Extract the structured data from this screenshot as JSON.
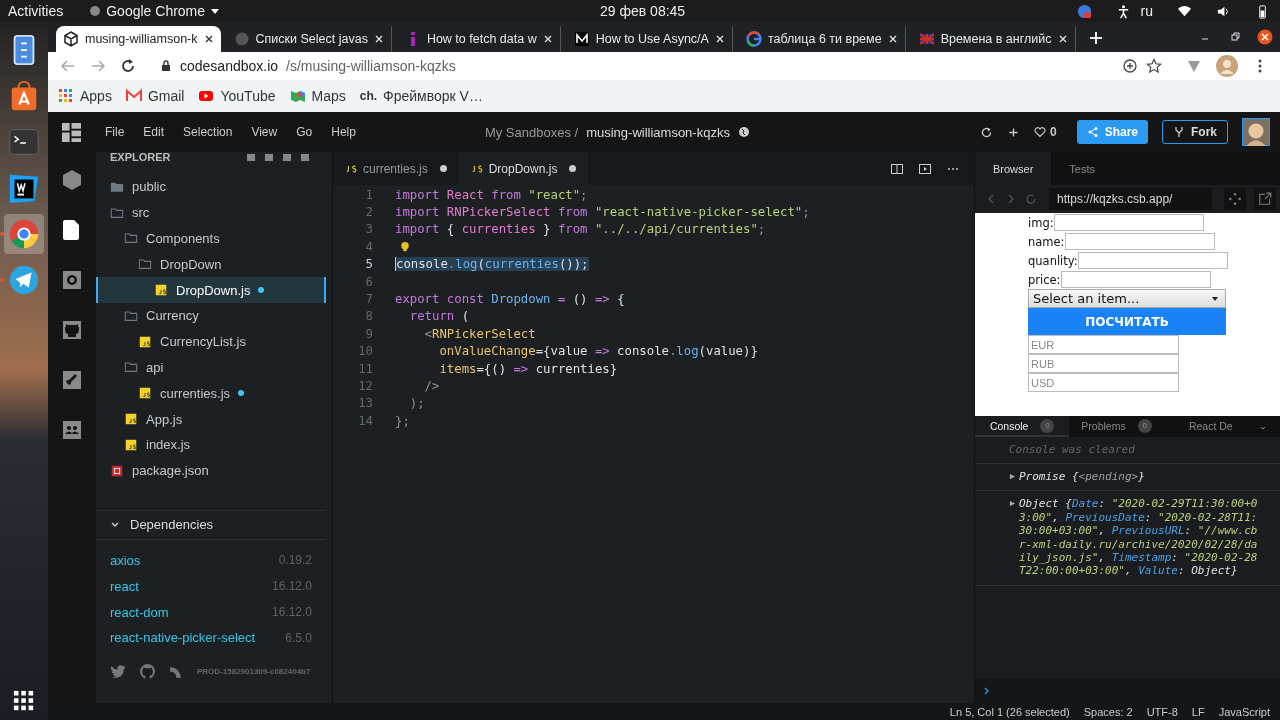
{
  "system_bar": {
    "activities": "Activities",
    "app_menu": "Google Chrome",
    "clock": "29 фев  08:45",
    "language": "ru"
  },
  "dock": [
    {
      "kind": "files",
      "selected": false,
      "running": false
    },
    {
      "kind": "store",
      "selected": false,
      "running": false
    },
    {
      "kind": "terminal",
      "selected": false,
      "running": false
    },
    {
      "kind": "webstorm",
      "selected": false,
      "running": false
    },
    {
      "kind": "chrome",
      "selected": true,
      "running": true
    },
    {
      "kind": "telegram",
      "selected": false,
      "running": true
    }
  ],
  "browser_tabs": [
    {
      "title": "musing-williamson-k",
      "kind": "cube",
      "selected": true
    },
    {
      "title": "Списки Select javas",
      "kind": "globe",
      "selected": false
    },
    {
      "title": "How to fetch data w",
      "kind": "purple",
      "selected": false
    },
    {
      "title": "How to Use Async/A",
      "kind": "medium",
      "selected": false
    },
    {
      "title": "таблица 6 ти време",
      "kind": "google",
      "selected": false
    },
    {
      "title": "Времена в английс",
      "kind": "flag",
      "selected": false
    }
  ],
  "address": {
    "host": "codesandbox.io",
    "path": "/s/musing-williamson-kqzks"
  },
  "bookmarks": [
    {
      "label": "Apps",
      "kind": "apps"
    },
    {
      "label": "Gmail",
      "kind": "gmail"
    },
    {
      "label": "YouTube",
      "kind": "youtube"
    },
    {
      "label": "Maps",
      "kind": "maps"
    },
    {
      "label": "Фреймворк V…",
      "kind": "text",
      "logo": "ch."
    }
  ],
  "menu": [
    "File",
    "Edit",
    "Selection",
    "View",
    "Go",
    "Help"
  ],
  "breadcrumb": {
    "parent": "My Sandboxes /",
    "name": "musing-williamson-kqzks"
  },
  "likes": "0",
  "share": "Share",
  "fork": "Fork",
  "activity": [
    {
      "kind": "cube",
      "selected": false
    },
    {
      "kind": "file",
      "selected": true
    },
    {
      "kind": "gear",
      "selected": false
    },
    {
      "kind": "github",
      "selected": false
    },
    {
      "kind": "rocket",
      "selected": false
    },
    {
      "kind": "people",
      "selected": false
    }
  ],
  "explorer": {
    "title": "EXPLORER",
    "tree": [
      {
        "name": "public",
        "kind": "folder",
        "expanded": false,
        "selected": false,
        "modified": false
      },
      {
        "name": "src",
        "kind": "folder",
        "expanded": true,
        "selected": false,
        "modified": false,
        "children": [
          {
            "name": "Components",
            "kind": "folder",
            "expanded": true,
            "selected": false,
            "modified": false,
            "children": [
              {
                "name": "DropDown",
                "kind": "folder",
                "expanded": true,
                "selected": false,
                "modified": false,
                "children": [
                  {
                    "name": "DropDown.js",
                    "kind": "js",
                    "selected": true,
                    "modified": true
                  }
                ]
              }
            ]
          },
          {
            "name": "Currency",
            "kind": "folder",
            "expanded": true,
            "selected": false,
            "modified": false,
            "children": [
              {
                "name": "CurrencyList.js",
                "kind": "js",
                "selected": false,
                "modified": false
              }
            ]
          },
          {
            "name": "api",
            "kind": "folder",
            "expanded": true,
            "selected": false,
            "modified": false,
            "children": [
              {
                "name": "currenties.js",
                "kind": "js",
                "selected": false,
                "modified": true
              }
            ]
          },
          {
            "name": "App.js",
            "kind": "js",
            "selected": false,
            "modified": false
          },
          {
            "name": "index.js",
            "kind": "js",
            "selected": false,
            "modified": false
          }
        ]
      },
      {
        "name": "package.json",
        "kind": "json",
        "selected": false,
        "modified": false
      }
    ]
  },
  "dependencies": {
    "title": "Dependencies",
    "expanded": true,
    "items": [
      {
        "name": "axios",
        "version": "0.19.2"
      },
      {
        "name": "react",
        "version": "16.12.0"
      },
      {
        "name": "react-dom",
        "version": "16.12.0"
      },
      {
        "name": "react-native-picker-select",
        "version": "6.5.0"
      }
    ]
  },
  "build": "PROD-1582901309-c082404b7",
  "editor_tabs": [
    {
      "name": "currenties.js",
      "selected": false,
      "modified": true
    },
    {
      "name": "DropDown.js",
      "selected": true,
      "modified": true
    }
  ],
  "code": [
    {
      "n": "1",
      "selected": false,
      "lightbulb": false,
      "tokens": [
        {
          "text": "import",
          "kind": "kw"
        },
        {
          "text": " React ",
          "kind": "nm"
        },
        {
          "text": "from",
          "kind": "kw"
        },
        {
          "text": " \"react\"",
          "kind": "str"
        },
        {
          "text": ";",
          "kind": "pn"
        }
      ]
    },
    {
      "n": "2",
      "selected": false,
      "lightbulb": false,
      "tokens": [
        {
          "text": "import",
          "kind": "kw"
        },
        {
          "text": " RNPickerSelect ",
          "kind": "nm"
        },
        {
          "text": "from",
          "kind": "kw"
        },
        {
          "text": " \"react-native-picker-select\"",
          "kind": "str"
        },
        {
          "text": ";",
          "kind": "pn"
        }
      ]
    },
    {
      "n": "3",
      "selected": false,
      "lightbulb": false,
      "tokens": [
        {
          "text": "import",
          "kind": "kw"
        },
        {
          "text": " { ",
          "kind": "pl"
        },
        {
          "text": "currenties",
          "kind": "nm"
        },
        {
          "text": " } ",
          "kind": "pl"
        },
        {
          "text": "from",
          "kind": "kw"
        },
        {
          "text": " \"../../api/currenties\"",
          "kind": "str"
        },
        {
          "text": ";",
          "kind": "pn"
        }
      ]
    },
    {
      "n": "4",
      "selected": false,
      "lightbulb": true
    },
    {
      "n": "5",
      "selected": true,
      "lightbulb": false,
      "tokens": [
        {
          "text": "console",
          "kind": "pl"
        },
        {
          "text": ".",
          "kind": "pn"
        },
        {
          "text": "log",
          "kind": "fn"
        },
        {
          "text": "(",
          "kind": "pl"
        },
        {
          "text": "currenties",
          "kind": "fn"
        },
        {
          "text": "());",
          "kind": "pl"
        }
      ]
    },
    {
      "n": "6",
      "selected": false,
      "lightbulb": false
    },
    {
      "n": "7",
      "selected": false,
      "lightbulb": false,
      "tokens": [
        {
          "text": "export const",
          "kind": "kw"
        },
        {
          "text": " Dropdown ",
          "kind": "fn"
        },
        {
          "text": "=",
          "kind": "kw"
        },
        {
          "text": " () ",
          "kind": "pl"
        },
        {
          "text": "=>",
          "kind": "kw"
        },
        {
          "text": " {",
          "kind": "pl"
        }
      ]
    },
    {
      "n": "8",
      "selected": false,
      "lightbulb": false,
      "tokens": [
        {
          "text": "  return",
          "kind": "kw"
        },
        {
          "text": " (",
          "kind": "pl"
        }
      ]
    },
    {
      "n": "9",
      "selected": false,
      "lightbulb": false,
      "tokens": [
        {
          "text": "    <",
          "kind": "pn"
        },
        {
          "text": "RNPickerSelect",
          "kind": "at"
        }
      ]
    },
    {
      "n": "10",
      "selected": false,
      "lightbulb": false,
      "tokens": [
        {
          "text": "      onValueChange",
          "kind": "at"
        },
        {
          "text": "={value ",
          "kind": "pl"
        },
        {
          "text": "=>",
          "kind": "kw"
        },
        {
          "text": " console",
          "kind": "pl"
        },
        {
          "text": ".",
          "kind": "pn"
        },
        {
          "text": "log",
          "kind": "fn"
        },
        {
          "text": "(value)}",
          "kind": "pl"
        }
      ]
    },
    {
      "n": "11",
      "selected": false,
      "lightbulb": false,
      "tokens": [
        {
          "text": "      items",
          "kind": "at"
        },
        {
          "text": "={() ",
          "kind": "pl"
        },
        {
          "text": "=>",
          "kind": "kw"
        },
        {
          "text": " currenties}",
          "kind": "pl"
        }
      ]
    },
    {
      "n": "12",
      "selected": false,
      "lightbulb": false,
      "tokens": [
        {
          "text": "    />",
          "kind": "pn"
        }
      ]
    },
    {
      "n": "13",
      "selected": false,
      "lightbulb": false,
      "tokens": [
        {
          "text": "  );",
          "kind": "pn"
        }
      ]
    },
    {
      "n": "14",
      "selected": false,
      "lightbulb": false,
      "tokens": [
        {
          "text": "};",
          "kind": "pn"
        }
      ]
    }
  ],
  "preview": {
    "tabs": [
      {
        "label": "Browser",
        "selected": true
      },
      {
        "label": "Tests",
        "selected": false
      }
    ],
    "url": "https://kqzks.csb.app/",
    "fields": [
      {
        "label": "img:"
      },
      {
        "label": "name:"
      },
      {
        "label": "quanlity:"
      },
      {
        "label": "price:"
      }
    ],
    "select": "Select an item...",
    "button": "ПОСЧИТАТЬ",
    "currency_fields": [
      {
        "placeholder": "EUR"
      },
      {
        "placeholder": "RUB"
      },
      {
        "placeholder": "USD"
      }
    ]
  },
  "devtools": {
    "tabs": [
      {
        "label": "Console",
        "count": "0",
        "selected": true
      },
      {
        "label": "Problems",
        "count": "0",
        "selected": false
      },
      {
        "label": "React De",
        "selected": false
      }
    ],
    "entries": [
      {
        "kind": "cleared",
        "text": "Console was cleared"
      },
      {
        "kind": "log",
        "tokens": [
          {
            "text": "Promise {",
            "kind": "pl"
          },
          {
            "text": "<pending>",
            "kind": "dim"
          },
          {
            "text": "}",
            "kind": "pl"
          }
        ]
      },
      {
        "kind": "log",
        "tokens": [
          {
            "text": "Object {",
            "kind": "pl"
          },
          {
            "text": "Date",
            "kind": "key"
          },
          {
            "text": ": ",
            "kind": "pl"
          },
          {
            "text": "\"2020-02-29T11:30:00+03:00\"",
            "kind": "str"
          },
          {
            "text": ", ",
            "kind": "pl"
          },
          {
            "text": "PreviousDate",
            "kind": "key"
          },
          {
            "text": ": ",
            "kind": "pl"
          },
          {
            "text": "\"2020-02-28T11:30:00+03:00\"",
            "kind": "str"
          },
          {
            "text": ", ",
            "kind": "pl"
          },
          {
            "text": "PreviousURL",
            "kind": "key"
          },
          {
            "text": ": ",
            "kind": "pl"
          },
          {
            "text": "\"//www.cbr-xml-daily.ru/archive/2020/02/28/daily_json.js\"",
            "kind": "str"
          },
          {
            "text": ", ",
            "kind": "pl"
          },
          {
            "text": "Timestamp",
            "kind": "key"
          },
          {
            "text": ": ",
            "kind": "pl"
          },
          {
            "text": "\"2020-02-28T22:00:00+03:00\"",
            "kind": "str"
          },
          {
            "text": ", ",
            "kind": "pl"
          },
          {
            "text": "Valute",
            "kind": "key"
          },
          {
            "text": ": Object}",
            "kind": "pl"
          }
        ]
      }
    ]
  },
  "status": [
    "Ln 5, Col 1 (26 selected)",
    "Spaces: 2",
    "UTF-8",
    "LF",
    "JavaScript"
  ]
}
